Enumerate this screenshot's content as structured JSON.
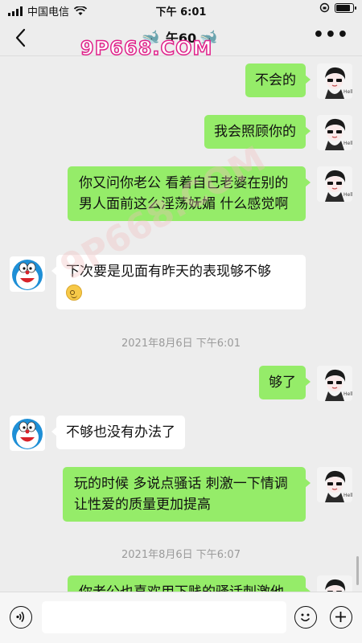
{
  "status_bar": {
    "carrier": "中国电信",
    "time": "下午 6:01",
    "icons": [
      "signal-icon",
      "wifi-icon",
      "rotation-lock-icon",
      "battery-icon"
    ],
    "battery_level": 0.85
  },
  "nav": {
    "title": "午60",
    "back_icon": "chevron-left-icon",
    "more_icon": "more-icon"
  },
  "watermark": {
    "site": "9P668.COM",
    "diagonal": "9P668.COM"
  },
  "messages": [
    {
      "type": "message",
      "side": "out",
      "text": "不会的"
    },
    {
      "type": "message",
      "side": "out",
      "text": "我会照顾你的"
    },
    {
      "type": "message",
      "side": "out",
      "text": "你又问你老公 看着自己老婆在别的男人面前这么淫荡妩媚 什么感觉啊"
    },
    {
      "type": "message",
      "side": "in",
      "text": "下次要是见面有昨天的表现够不够",
      "emoji": "smile-emoji"
    },
    {
      "type": "timestamp",
      "text": "2021年8月6日 下午6:01"
    },
    {
      "type": "message",
      "side": "out",
      "text": "够了"
    },
    {
      "type": "message",
      "side": "in",
      "text": "不够也没有办法了"
    },
    {
      "type": "message",
      "side": "out",
      "text": "玩的时候 多说点骚话 刺激一下情调 让性爱的质量更加提高"
    },
    {
      "type": "timestamp",
      "text": "2021年8月6日 下午6:07"
    },
    {
      "type": "message",
      "side": "out",
      "text": "你老公也喜欢用下贱的骚话刺激他"
    }
  ],
  "input_bar": {
    "placeholder": "",
    "icons": [
      "voice-icon",
      "emoji-icon",
      "plus-icon"
    ]
  },
  "colors": {
    "outgoing_bubble": "#95ec69",
    "incoming_bubble": "#ffffff",
    "background": "#ededed"
  }
}
